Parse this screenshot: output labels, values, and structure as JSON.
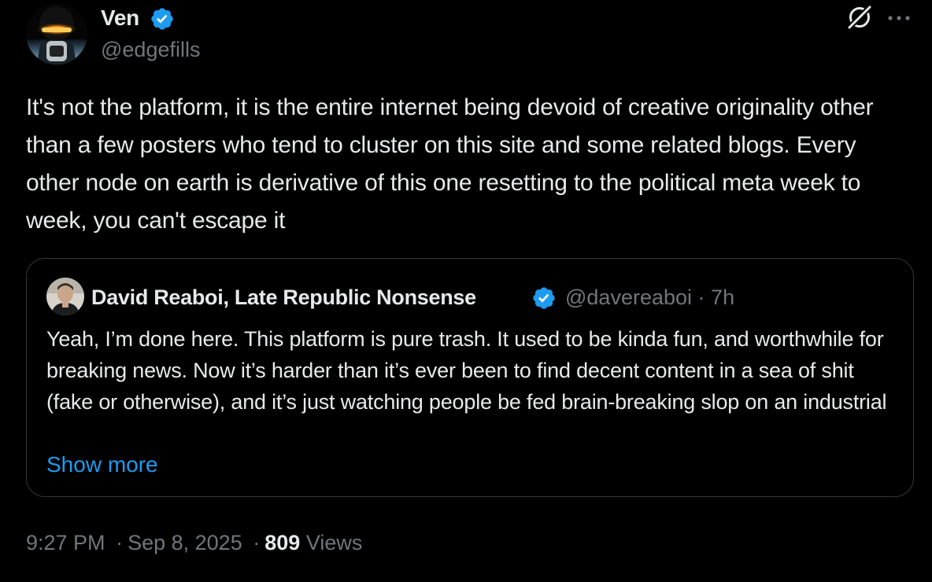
{
  "author": {
    "name": "Ven",
    "handle": "@edgefills",
    "verified": true
  },
  "tweet": {
    "text": "It's not the platform, it is the entire internet being devoid of creative originality other than a few posters who tend to cluster on this site and some related blogs. Every other node on earth is derivative of this one resetting to the political meta week to week, you can't escape it",
    "time": "9:27 PM",
    "date": "Sep 8, 2025",
    "views_count": "809",
    "views_label": "Views",
    "separator": "·"
  },
  "quote": {
    "author_name": "David Reaboi, Late Republic Nonsense",
    "author_handle": "@davereaboi",
    "age": "7h",
    "separator": "·",
    "verified": true,
    "text": "Yeah, I’m done here. This platform is pure trash. It used to be kinda fun, and worthwhile for breaking news. Now it’s harder than it’s ever been to find decent content in a sea of shit (fake or otherwise), and it’s just watching people be fed brain-breaking slop on an industrial",
    "show_more": "Show more"
  },
  "icons": {
    "verified": "verified-badge-icon",
    "grok": "grok-icon",
    "more": "more-horizontal-icon"
  },
  "colors": {
    "background": "#000000",
    "text_primary": "#e7e9ea",
    "text_secondary": "#71767b",
    "accent": "#1d9bf0",
    "border": "#333639"
  }
}
